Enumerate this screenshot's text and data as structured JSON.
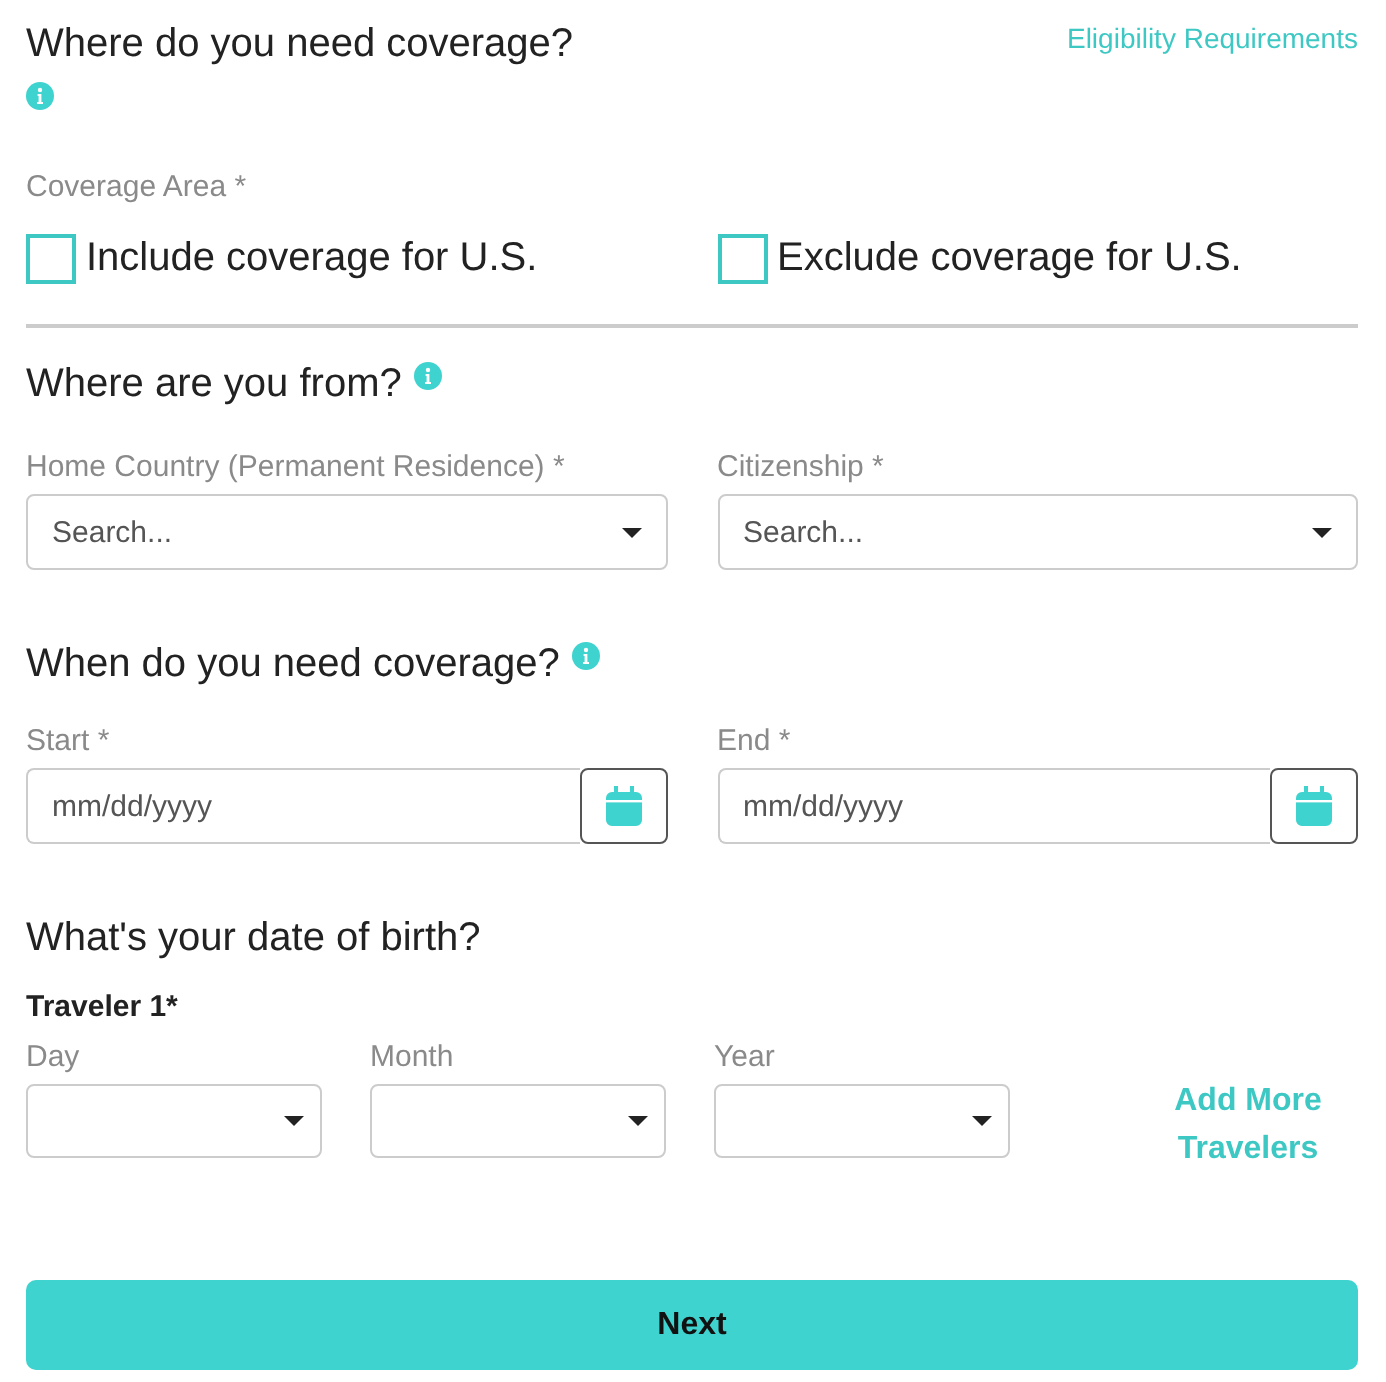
{
  "coverage": {
    "title": "Where do you need coverage?",
    "link": "Eligibility Requirements",
    "area_label": "Coverage Area *",
    "options": [
      {
        "label": "Include coverage for U.S.",
        "checked": false
      },
      {
        "label": "Exclude coverage for U.S.",
        "checked": false
      }
    ]
  },
  "origin": {
    "title": "Where are you from?",
    "fields": [
      {
        "label": "Home Country (Permanent Residence) *",
        "placeholder": "Search..."
      },
      {
        "label": "Citizenship *",
        "placeholder": "Search..."
      }
    ]
  },
  "dates": {
    "title": "When do you need coverage?",
    "fields": [
      {
        "label": "Start *",
        "placeholder": "mm/dd/yyyy"
      },
      {
        "label": "End *",
        "placeholder": "mm/dd/yyyy"
      }
    ]
  },
  "birth": {
    "title": "What's your date of birth?",
    "traveler": "Traveler 1*",
    "fields": [
      {
        "label": "Day"
      },
      {
        "label": "Month"
      },
      {
        "label": "Year"
      }
    ],
    "add_link": "Add More Travelers"
  },
  "next_button": "Next"
}
